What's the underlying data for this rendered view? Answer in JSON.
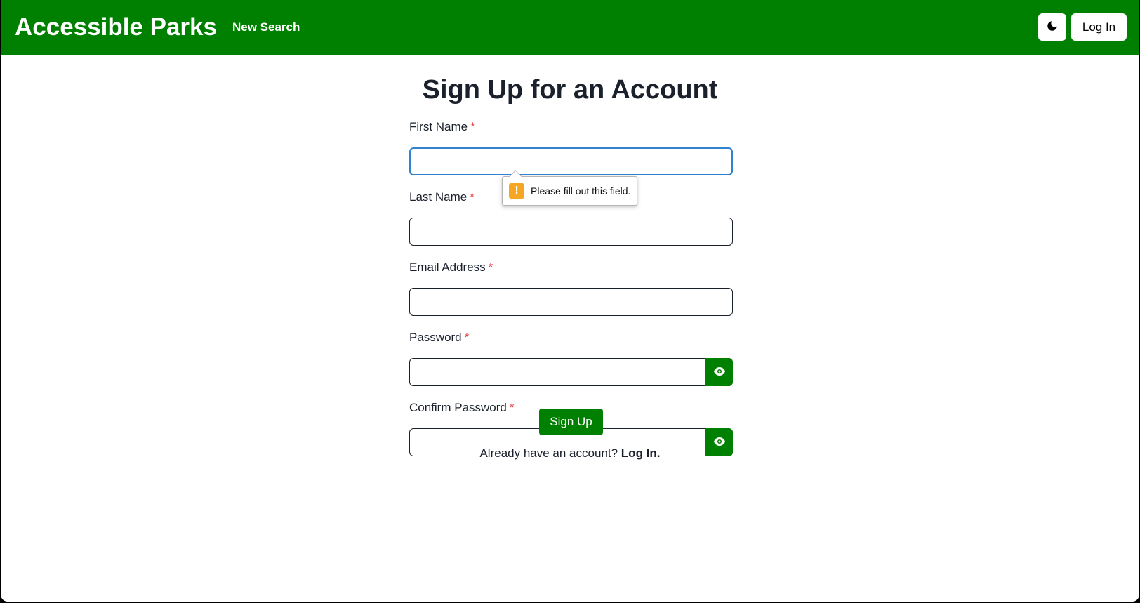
{
  "navbar": {
    "brand": "Accessible Parks",
    "new_search": "New Search",
    "theme_icon": "moon-icon",
    "login_label": "Log In",
    "background": "#008000"
  },
  "page": {
    "title": "Sign Up for an Account"
  },
  "form": {
    "required_marker": "*",
    "fields": [
      {
        "label": "First Name",
        "value": ""
      },
      {
        "label": "Last Name",
        "value": ""
      },
      {
        "label": "Email Address",
        "value": ""
      },
      {
        "label": "Password",
        "value": ""
      },
      {
        "label": "Confirm Password",
        "value": ""
      }
    ],
    "toggle_icon": "eye-icon",
    "submit_label": "Sign Up",
    "footer_text": "Already have an account?",
    "footer_link": "Log In."
  },
  "validation": {
    "message": "Please fill out this field.",
    "icon": "warning-icon",
    "icon_color": "#f5a623"
  },
  "colors": {
    "accent": "#008000",
    "focus": "#3182ce",
    "required": "#e53e3e"
  }
}
